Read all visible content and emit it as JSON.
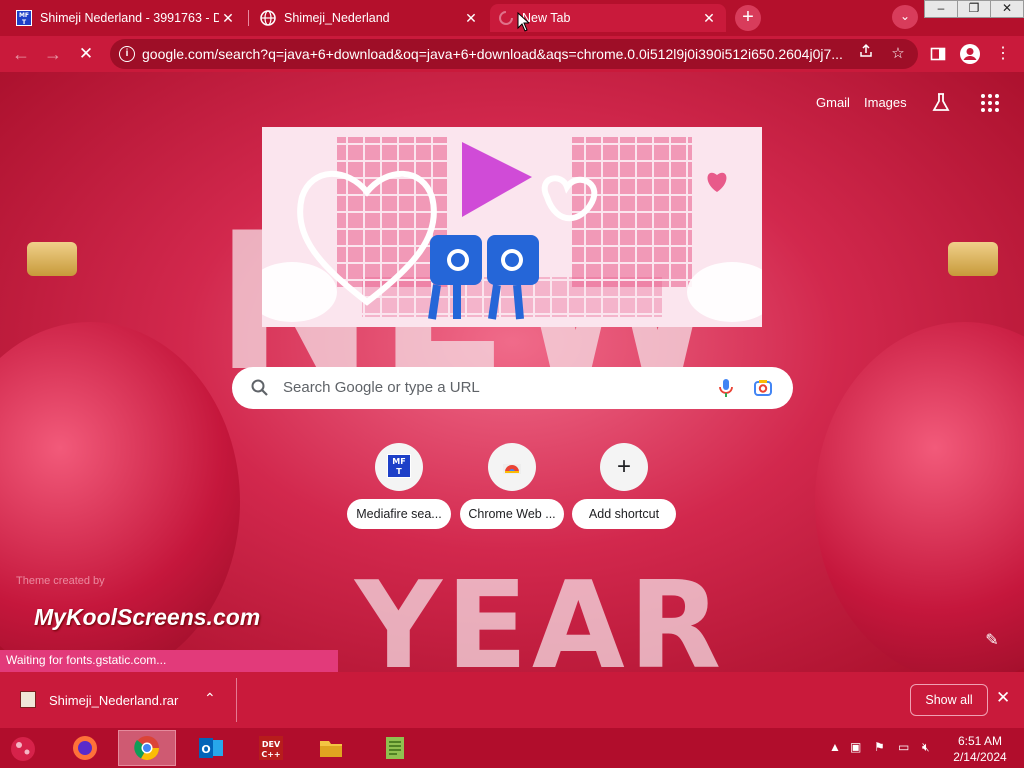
{
  "tabs": [
    {
      "title": "Shimeji Nederland - 3991763 - D",
      "icon": "mft-icon"
    },
    {
      "title": "Shimeji_Nederland",
      "icon": "globe-icon"
    },
    {
      "title": "New Tab",
      "icon": "loading-spinner-icon",
      "active": true
    }
  ],
  "address": {
    "url": "google.com/search?q=java+6+download&oq=java+6+download&aqs=chrome.0.0i512l9j0i390i512i650.2604j0j7..."
  },
  "newtab": {
    "gmail": "Gmail",
    "images": "Images",
    "search_placeholder": "Search Google or type a URL",
    "shortcuts": [
      {
        "label": "Mediafire sea...",
        "icon": "mft-icon"
      },
      {
        "label": "Chrome Web ...",
        "icon": "chrome-web-store-icon"
      },
      {
        "label": "Add shortcut",
        "icon": "plus-icon"
      }
    ],
    "theme_credit": "Theme created by",
    "brand": "MyKoolScreens.com"
  },
  "status_text": "Waiting for fonts.gstatic.com...",
  "download": {
    "file": "Shimeji_Nederland.rar",
    "show_all": "Show all"
  },
  "clock": {
    "time": "6:51 AM",
    "date": "2/14/2024"
  },
  "colors": {
    "accent": "#c91a3b",
    "tabbar": "#b4102c",
    "status": "#e23a7a"
  }
}
